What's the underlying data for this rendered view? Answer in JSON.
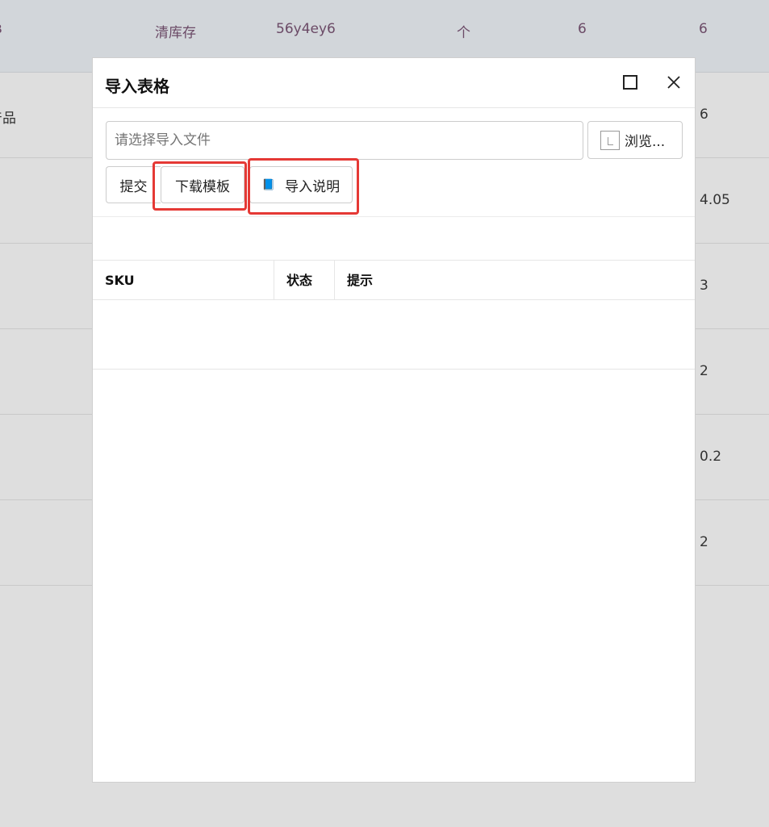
{
  "background_table": {
    "header_row": {
      "left": "฿",
      "type": "清库存",
      "sku": "56y4ey6",
      "unit": "个",
      "qty1": "6",
      "qty2": "6"
    },
    "rows": [
      {
        "left": "产品",
        "right": "6"
      },
      {
        "left": "฿",
        "right": "4.05"
      },
      {
        "left": "฿",
        "right": "3"
      },
      {
        "left": "฿",
        "right": "2"
      },
      {
        "left": "฿",
        "right": "0.2"
      },
      {
        "left": "฿",
        "right": "2"
      }
    ]
  },
  "modal": {
    "title": "导入表格",
    "file_input": {
      "placeholder": "请选择导入文件",
      "value": ""
    },
    "browse_label": "浏览...",
    "submit_label": "提交",
    "template_label": "下载模板",
    "guide_label": "导入说明",
    "table": {
      "columns": [
        "SKU",
        "状态",
        "提示"
      ],
      "rows": []
    },
    "icons": {
      "maximize": "maximize-icon",
      "close": "close-icon",
      "browse": "file-icon",
      "guide": "book-icon"
    },
    "highlight_color": "#e53935"
  }
}
